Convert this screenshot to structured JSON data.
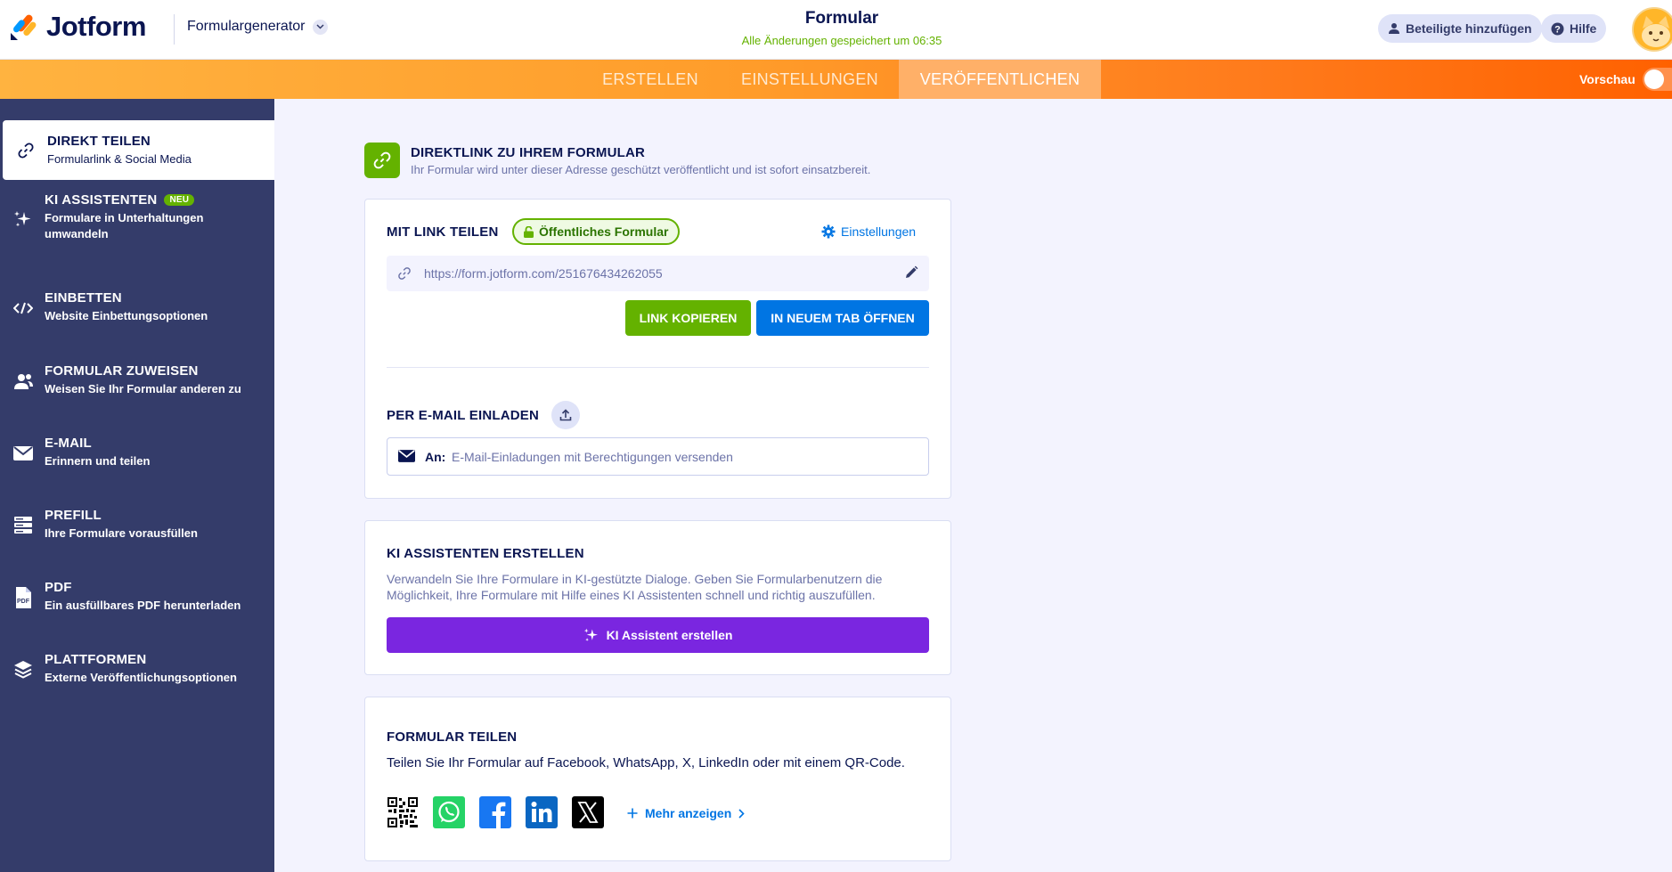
{
  "header": {
    "logo_text": "Jotform",
    "builder_select": "Formulargenerator",
    "form_title": "Formular",
    "save_status": "Alle Änderungen gespeichert um 06:35",
    "add_participants": "Beteiligte hinzufügen",
    "help": "Hilfe"
  },
  "nav": {
    "tabs": [
      "ERSTELLEN",
      "EINSTELLUNGEN",
      "VERÖFFENTLICHEN"
    ],
    "active_tab": "VERÖFFENTLICHEN",
    "preview_label": "Vorschau",
    "preview_on": false
  },
  "sidebar": {
    "items": [
      {
        "title": "DIREKT TEILEN",
        "desc": "Formularlink & Social Media",
        "icon": "link-icon",
        "active": true
      },
      {
        "title": "KI ASSISTENTEN",
        "badge": "NEU",
        "desc": "Formulare in Unterhaltungen umwandeln",
        "icon": "sparkle-icon"
      },
      {
        "title": "EINBETTEN",
        "desc": "Website Einbettungsoptionen",
        "icon": "code-icon"
      },
      {
        "title": "FORMULAR ZUWEISEN",
        "desc": "Weisen Sie Ihr Formular anderen zu",
        "icon": "users-icon"
      },
      {
        "title": "E-MAIL",
        "desc": "Erinnern und teilen",
        "icon": "envelope-icon"
      },
      {
        "title": "PREFILL",
        "desc": "Ihre Formulare vorausfüllen",
        "icon": "prefill-icon"
      },
      {
        "title": "PDF",
        "desc": "Ein ausfüllbares PDF herunterladen",
        "icon": "pdf-icon"
      },
      {
        "title": "PLATTFORMEN",
        "desc": "Externe Veröffentlichungsoptionen",
        "icon": "layers-icon"
      }
    ]
  },
  "hero": {
    "title": "DIREKTLINK ZU IHREM FORMULAR",
    "subtitle": "Ihr Formular wird unter dieser Adresse geschützt veröffentlicht und ist sofort einsatzbereit."
  },
  "link_share": {
    "title": "MIT LINK TEILEN",
    "badge": "Öffentliches Formular",
    "settings": "Einstellungen",
    "url": "https://form.jotform.com/251676434262055",
    "copy_button": "LINK KOPIEREN",
    "open_button": "IN NEUEM TAB ÖFFNEN"
  },
  "email_invite": {
    "title": "PER E-MAIL EINLADEN",
    "to_label": "An:",
    "placeholder": "E-Mail-Einladungen mit Berechtigungen versenden"
  },
  "ai_card": {
    "title": "KI ASSISTENTEN ERSTELLEN",
    "desc": "Verwandeln Sie Ihre Formulare in KI-gestützte Dialoge. Geben Sie Formularbenutzern die Möglichkeit, Ihre Formulare mit Hilfe eines KI Assistenten schnell und richtig auszufüllen.",
    "button": "KI Assistent erstellen"
  },
  "share_card": {
    "title": "FORMULAR TEILEN",
    "desc": "Teilen Sie Ihr Formular auf Facebook, WhatsApp, X, LinkedIn oder mit einem QR-Code.",
    "icons": [
      "qr-code-icon",
      "whatsapp-icon",
      "facebook-icon",
      "linkedin-icon",
      "x-icon"
    ],
    "more": "Mehr anzeigen"
  },
  "colors": {
    "accent_orange": "#ff6100",
    "sidebar": "#343c6a",
    "green": "#64b200",
    "blue": "#0075e3",
    "purple": "#7a26e0"
  }
}
